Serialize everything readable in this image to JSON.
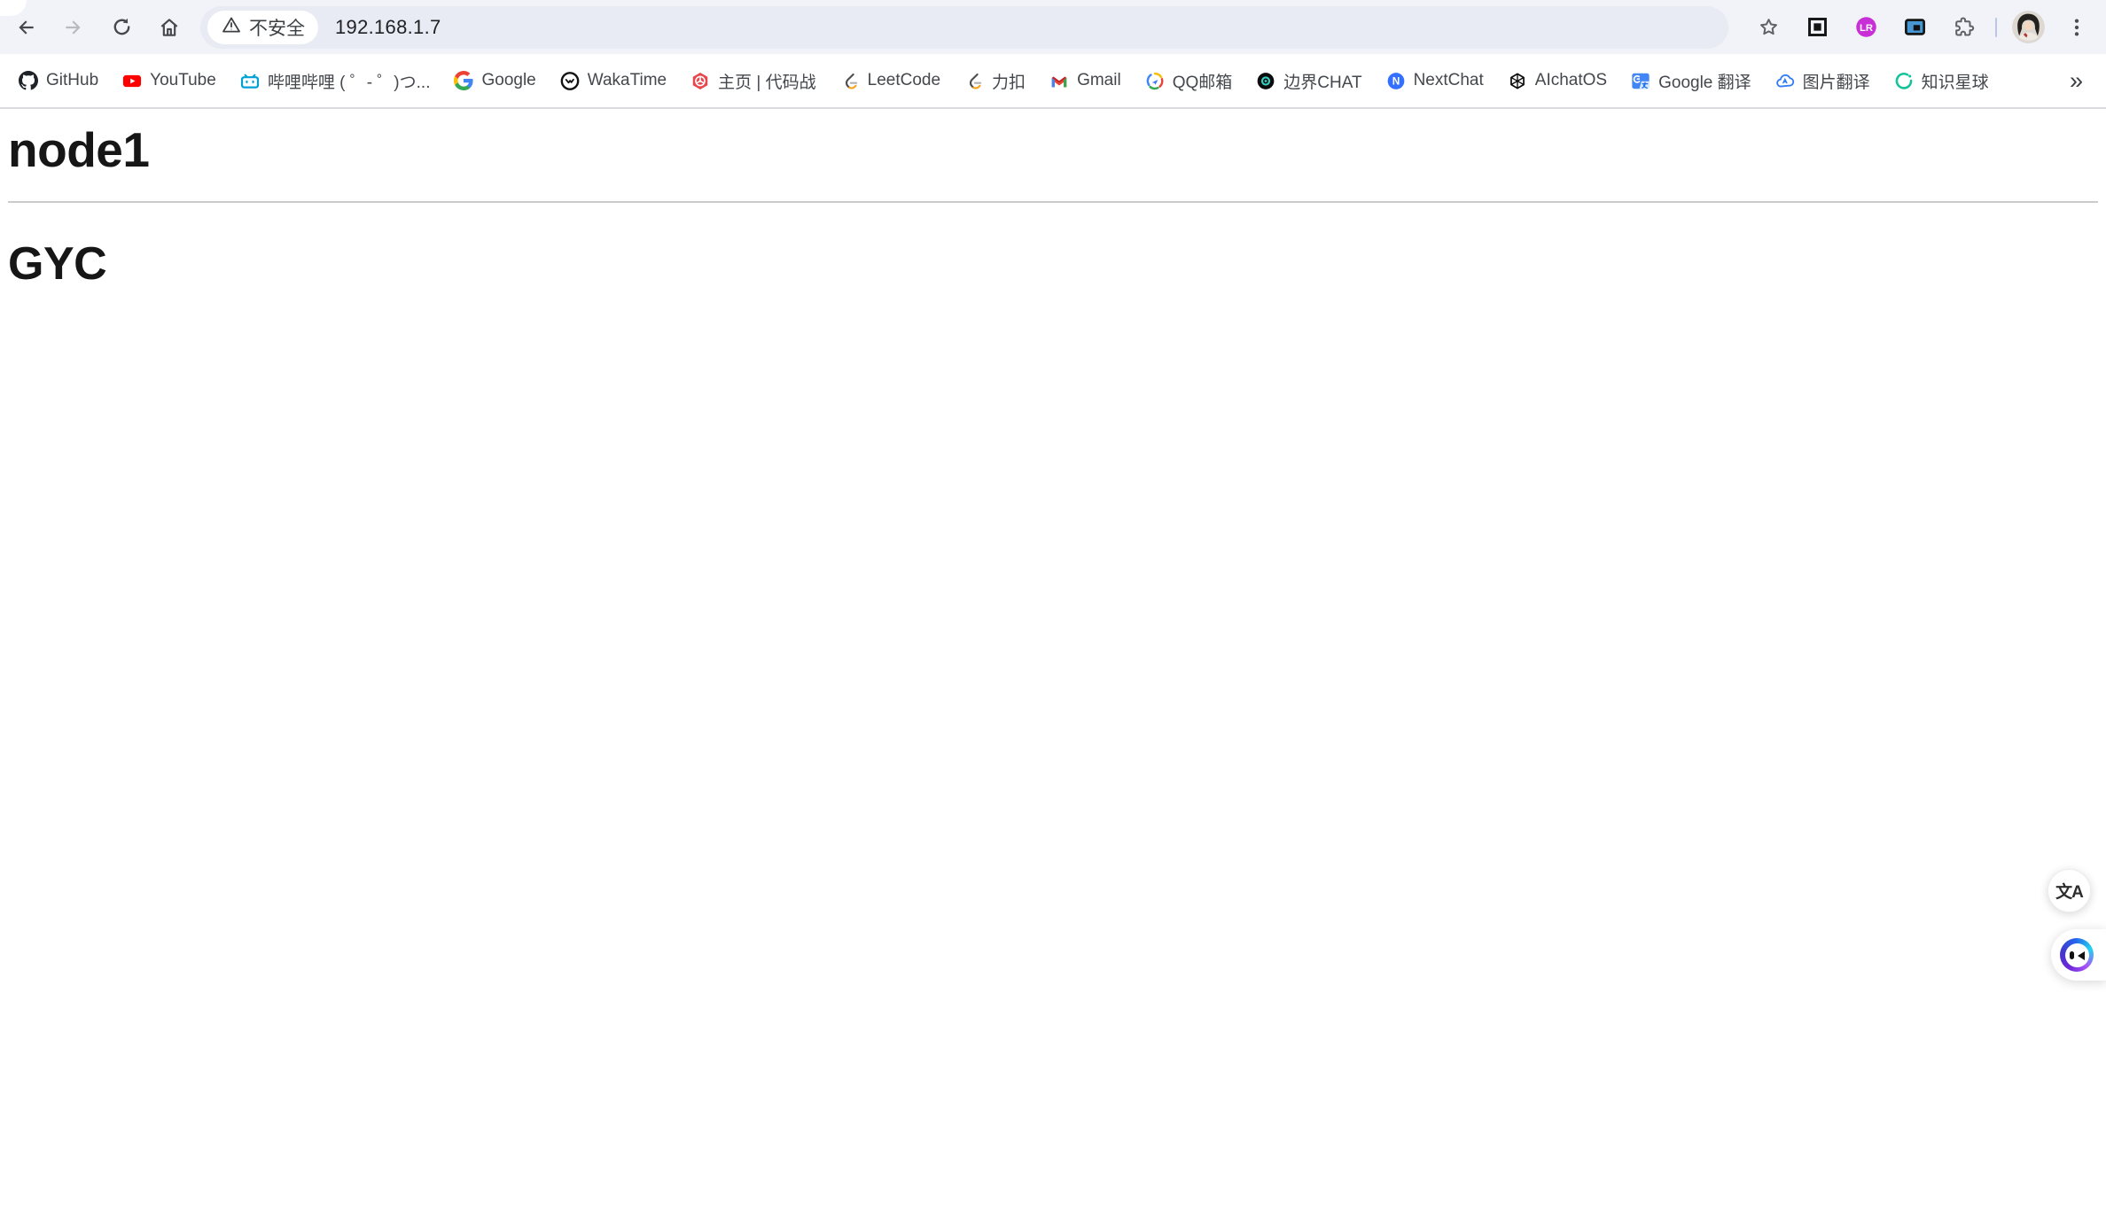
{
  "toolbar": {
    "security_chip": "不安全",
    "url": "192.168.1.7",
    "icons": [
      "back-arrow-icon",
      "forward-arrow-icon",
      "reload-icon",
      "home-icon",
      "warning-triangle-icon",
      "bookmark-star-icon",
      "boxed-square-extension-icon",
      "lr-extension-icon",
      "picture-in-picture-extension-icon",
      "extensions-puzzle-icon",
      "profile-avatar",
      "menu-kebab-icon"
    ]
  },
  "bookmarks": {
    "items": [
      {
        "id": "github",
        "label": "GitHub",
        "icon": "github-icon"
      },
      {
        "id": "youtube",
        "label": "YouTube",
        "icon": "youtube-icon"
      },
      {
        "id": "bilibili",
        "label": "哔哩哔哩 ( ゜- ゜)つ...",
        "icon": "bilibili-icon"
      },
      {
        "id": "google",
        "label": "Google",
        "icon": "google-icon"
      },
      {
        "id": "wakatime",
        "label": "WakaTime",
        "icon": "wakatime-icon"
      },
      {
        "id": "daimazhan",
        "label": "主页 | 代码战",
        "icon": "red-pinwheel-icon"
      },
      {
        "id": "leetcode",
        "label": "LeetCode",
        "icon": "leetcode-icon"
      },
      {
        "id": "likou",
        "label": "力扣",
        "icon": "leetcode-icon"
      },
      {
        "id": "gmail",
        "label": "Gmail",
        "icon": "gmail-icon"
      },
      {
        "id": "qqmail",
        "label": "QQ邮箱",
        "icon": "qqmail-icon"
      },
      {
        "id": "bianjie-chat",
        "label": "边界CHAT",
        "icon": "dark-eye-icon"
      },
      {
        "id": "nextchat",
        "label": "NextChat",
        "icon": "nextchat-icon"
      },
      {
        "id": "aichatos",
        "label": "AIchatOS",
        "icon": "openai-knot-icon"
      },
      {
        "id": "google-translate",
        "label": "Google 翻译",
        "icon": "google-translate-icon"
      },
      {
        "id": "pic-translate",
        "label": "图片翻译",
        "icon": "cloud-translate-icon"
      },
      {
        "id": "zsxq",
        "label": "知识星球",
        "icon": "green-arc-icon"
      }
    ],
    "overflow_label": "»"
  },
  "page": {
    "heading": "node1",
    "subheading": "GYC"
  },
  "floating": {
    "translate_label": "文A"
  },
  "colors": {
    "toolbar_bg": "#f2f3f9",
    "omnibox_bg": "#e9ebf4",
    "chip_bg": "#ffffff",
    "bookmarks_divider": "#dadce0",
    "youtube_red": "#ff0000",
    "bilibili_blue": "#00a1d6",
    "nextchat_blue": "#3370ff",
    "leetcode_orange": "#ffa116",
    "gmail_red": "#ea4335",
    "zsxq_green": "#15c39a",
    "lr_extension_magenta": "#c92fd6",
    "monica_purple": "#6d28d9"
  }
}
